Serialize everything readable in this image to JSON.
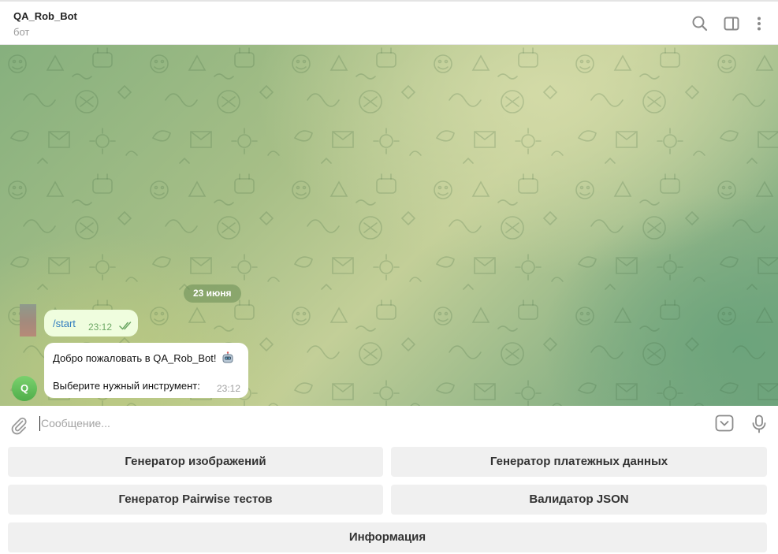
{
  "header": {
    "title": "QA_Rob_Bot",
    "subtitle": "бот",
    "icons": [
      "search-icon",
      "sidebar-panel-icon",
      "more-vertical-icon"
    ]
  },
  "chat": {
    "date_separator": "23 июня",
    "messages": [
      {
        "direction": "outgoing",
        "text": "/start",
        "time": "23:12",
        "status": "read"
      },
      {
        "direction": "incoming",
        "line1": "Добро пожаловать в QA_Rob_Bot!",
        "emoji_icon": "robot-icon",
        "line2": "Выберите нужный инструмент:",
        "time": "23:12",
        "avatar_letter": "Q"
      }
    ]
  },
  "composer": {
    "placeholder": "Сообщение...",
    "value": ""
  },
  "keyboard": {
    "rows": [
      [
        "Генератор изображений",
        "Генератор платежных данных"
      ],
      [
        "Генератор Pairwise тестов",
        "Валидатор JSON"
      ],
      [
        "Информация"
      ]
    ]
  },
  "colors": {
    "outgoing_bubble": "#effdde",
    "link_blue": "#2f7cbf",
    "read_check_green": "#6da865",
    "avatar_green": "#4fae4a",
    "keyboard_button_bg": "#f0f0f0"
  }
}
